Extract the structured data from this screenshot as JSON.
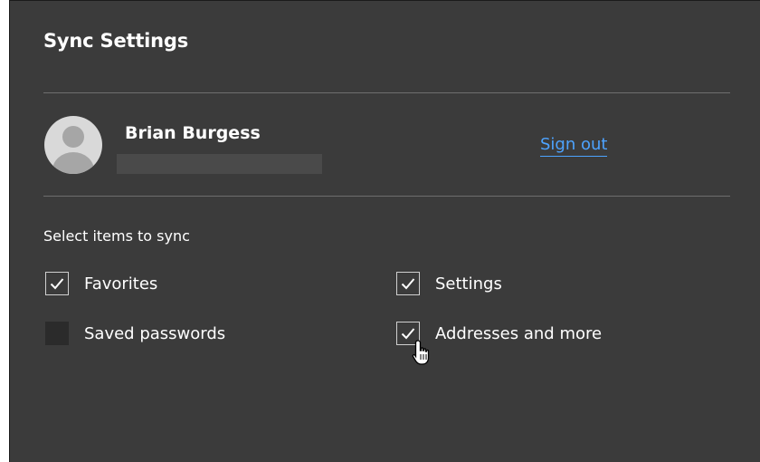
{
  "panel": {
    "title": "Sync Settings"
  },
  "account": {
    "name": "Brian Burgess",
    "sign_out_label": "Sign out",
    "avatar_icon": "person-icon"
  },
  "sync": {
    "section_label": "Select items to sync",
    "items": [
      {
        "label": "Favorites",
        "checked": true
      },
      {
        "label": "Settings",
        "checked": true
      },
      {
        "label": "Saved passwords",
        "checked": false
      },
      {
        "label": "Addresses and more",
        "checked": true
      }
    ]
  },
  "colors": {
    "background": "#3b3b3b",
    "link": "#4da3ff",
    "text": "#ffffff"
  }
}
